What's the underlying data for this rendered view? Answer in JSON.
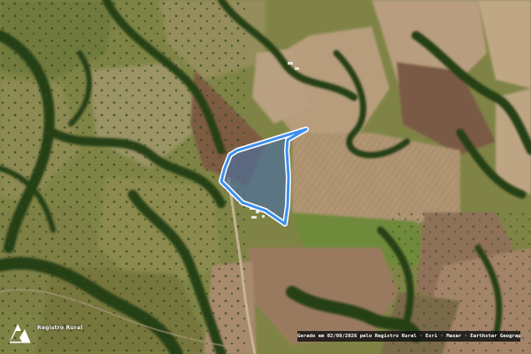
{
  "map": {
    "view": "satellite imagery",
    "land_cover_colors": {
      "forest": "#2e4a1a",
      "pasture": "#8a8a4a",
      "bare_field": "#b49a78",
      "plowed_field": "#7a5a42"
    },
    "area_polygon": {
      "fill_color": "#4f6f9a",
      "stroke_color": "#3d8ff0",
      "outline_color": "#ffffff"
    }
  },
  "branding": {
    "name": "Registro Rural",
    "icon": "registro-rural-logo-icon"
  },
  "attribution": {
    "text": "Gerado em 02/08/2026 pelo Registro Rural · Esri · Maxar · Earthstar Geographics"
  }
}
